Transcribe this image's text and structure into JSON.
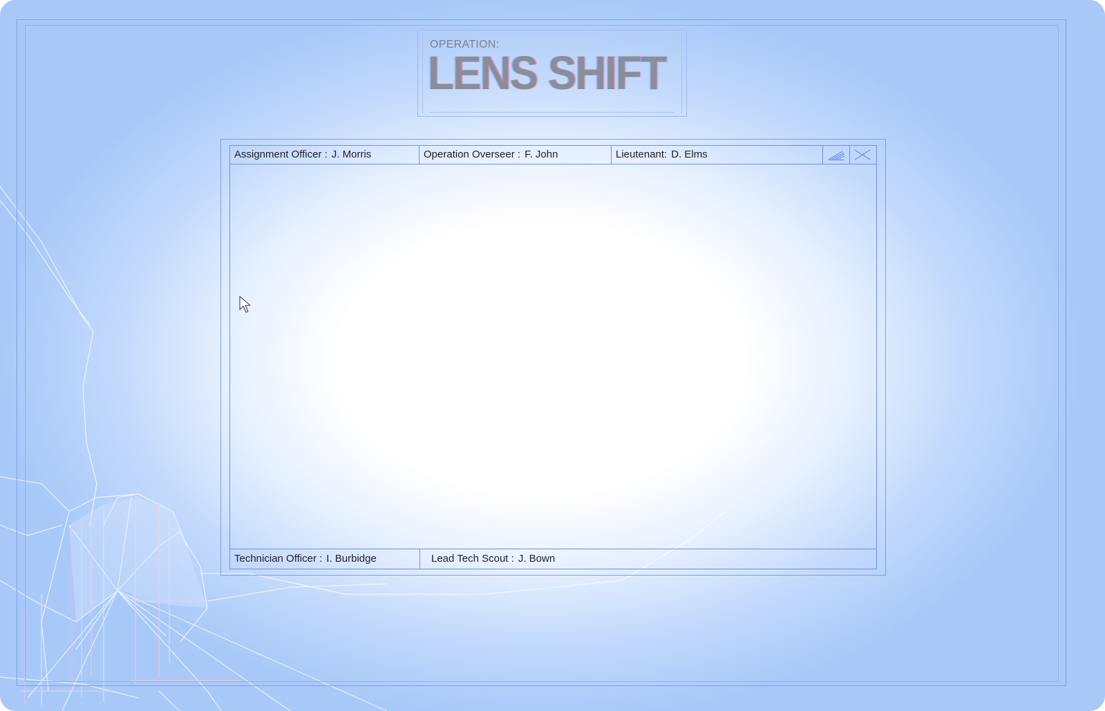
{
  "logo": {
    "prefix": "OPERATION:",
    "title": "LENS SHIFT"
  },
  "window": {
    "header": [
      {
        "label": "Assignment Officer :",
        "value": "J. Morris"
      },
      {
        "label": "Operation Overseer :",
        "value": "F. John"
      },
      {
        "label": "Lieutenant:",
        "value": "D. Elms"
      }
    ],
    "controls": [
      {
        "name": "resize-icon"
      },
      {
        "name": "close-icon"
      }
    ],
    "footer": [
      {
        "label": "Technician Officer :",
        "value": "I. Burbidge"
      },
      {
        "label": "Lead Tech Scout :",
        "value": "J. Bown"
      }
    ]
  },
  "colors": {
    "accent": "#6f8fe4",
    "background_edge": "#a8c9f8",
    "background_center": "#ffffff",
    "text": "#1e1e28",
    "logo_text": "#8a8e9b"
  }
}
